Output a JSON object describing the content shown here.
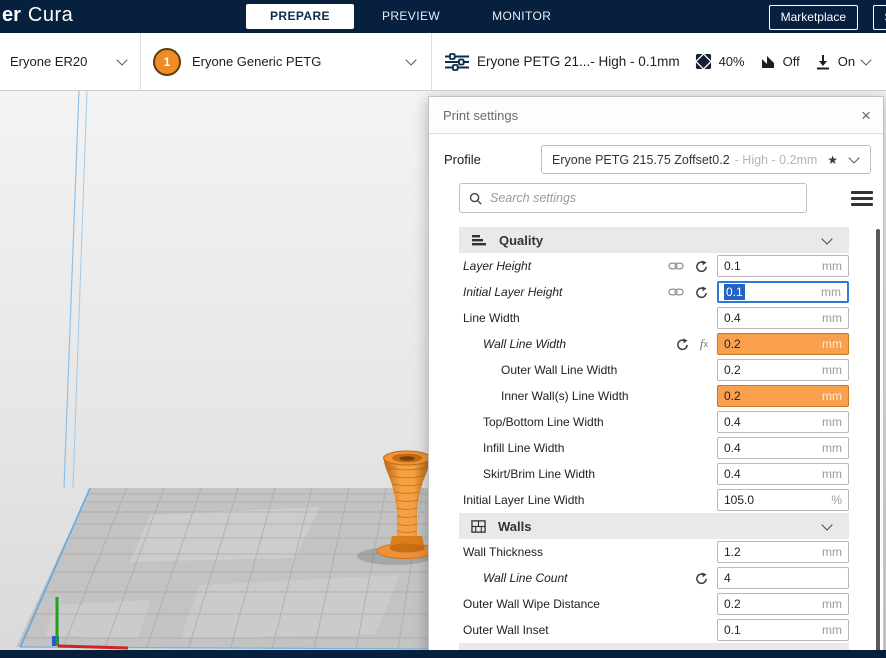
{
  "colors": {
    "topbar_navy": "#06203E",
    "accent_orange": "#F08C28",
    "warning_field_bg": "#F8A04E",
    "focus_blue": "#2D7BD8",
    "selection_blue": "#2663C5",
    "build_plate_blue": "#5EA9E2"
  },
  "topbar": {
    "logo_bold": "er",
    "logo_light": "Cura",
    "tabs": [
      {
        "label": "PREPARE",
        "active": true
      },
      {
        "label": "PREVIEW",
        "active": false
      },
      {
        "label": "MONITOR",
        "active": false
      }
    ],
    "marketplace": "Marketplace",
    "signin_partial": "Si"
  },
  "toolbar": {
    "printer_name": "Eryone ER20",
    "extruder_number": "1",
    "material_name": "Eryone Generic PETG",
    "profile_summary": "Eryone PETG 21...- High - 0.1mm",
    "infill_value": "40%",
    "support_value": "Off",
    "adhesion_value": "On"
  },
  "panel": {
    "title": "Print settings",
    "close_glyph": "×",
    "profile_label": "Profile",
    "profile_name": "Eryone PETG 215.75 Zoffset0.2",
    "profile_suffix": "- High - 0.2mm",
    "search_placeholder": "Search settings",
    "icons": {
      "star": "★",
      "fx_f": "f",
      "fx_x": "x"
    },
    "sections": {
      "quality": "Quality",
      "walls": "Walls"
    },
    "rows": [
      {
        "label": "Layer Height",
        "value": "0.1",
        "unit": "mm",
        "indent": 0,
        "italic": true,
        "icons": [
          "link",
          "revert"
        ],
        "state": "normal"
      },
      {
        "label": "Initial Layer Height",
        "value": "0.1",
        "unit": "mm",
        "indent": 0,
        "italic": true,
        "icons": [
          "link",
          "revert"
        ],
        "state": "focused-text-selected"
      },
      {
        "label": "Line Width",
        "value": "0.4",
        "unit": "mm",
        "indent": 0,
        "italic": false,
        "icons": [],
        "state": "normal"
      },
      {
        "label": "Wall Line Width",
        "value": "0.2",
        "unit": "mm",
        "indent": 1,
        "italic": true,
        "icons": [
          "revert",
          "fx"
        ],
        "state": "warning"
      },
      {
        "label": "Outer Wall Line Width",
        "value": "0.2",
        "unit": "mm",
        "indent": 2,
        "italic": false,
        "icons": [],
        "state": "normal"
      },
      {
        "label": "Inner Wall(s) Line Width",
        "value": "0.2",
        "unit": "mm",
        "indent": 2,
        "italic": false,
        "icons": [],
        "state": "warning"
      },
      {
        "label": "Top/Bottom Line Width",
        "value": "0.4",
        "unit": "mm",
        "indent": 1,
        "italic": false,
        "icons": [],
        "state": "normal"
      },
      {
        "label": "Infill Line Width",
        "value": "0.4",
        "unit": "mm",
        "indent": 1,
        "italic": false,
        "icons": [],
        "state": "normal"
      },
      {
        "label": "Skirt/Brim Line Width",
        "value": "0.4",
        "unit": "mm",
        "indent": 1,
        "italic": false,
        "icons": [],
        "state": "normal"
      },
      {
        "label": "Initial Layer Line Width",
        "value": "105.0",
        "unit": "%",
        "indent": 0,
        "italic": false,
        "icons": [],
        "state": "normal"
      },
      {
        "label": "Wall Thickness",
        "value": "1.2",
        "unit": "mm",
        "indent": 0,
        "italic": false,
        "icons": [],
        "state": "normal"
      },
      {
        "label": "Wall Line Count",
        "value": "4",
        "unit": "",
        "indent": 1,
        "italic": true,
        "icons": [
          "revert"
        ],
        "state": "normal"
      },
      {
        "label": "Outer Wall Wipe Distance",
        "value": "0.2",
        "unit": "mm",
        "indent": 0,
        "italic": false,
        "icons": [],
        "state": "normal"
      },
      {
        "label": "Outer Wall Inset",
        "value": "0.1",
        "unit": "mm",
        "indent": 0,
        "italic": false,
        "icons": [],
        "state": "normal"
      }
    ]
  }
}
